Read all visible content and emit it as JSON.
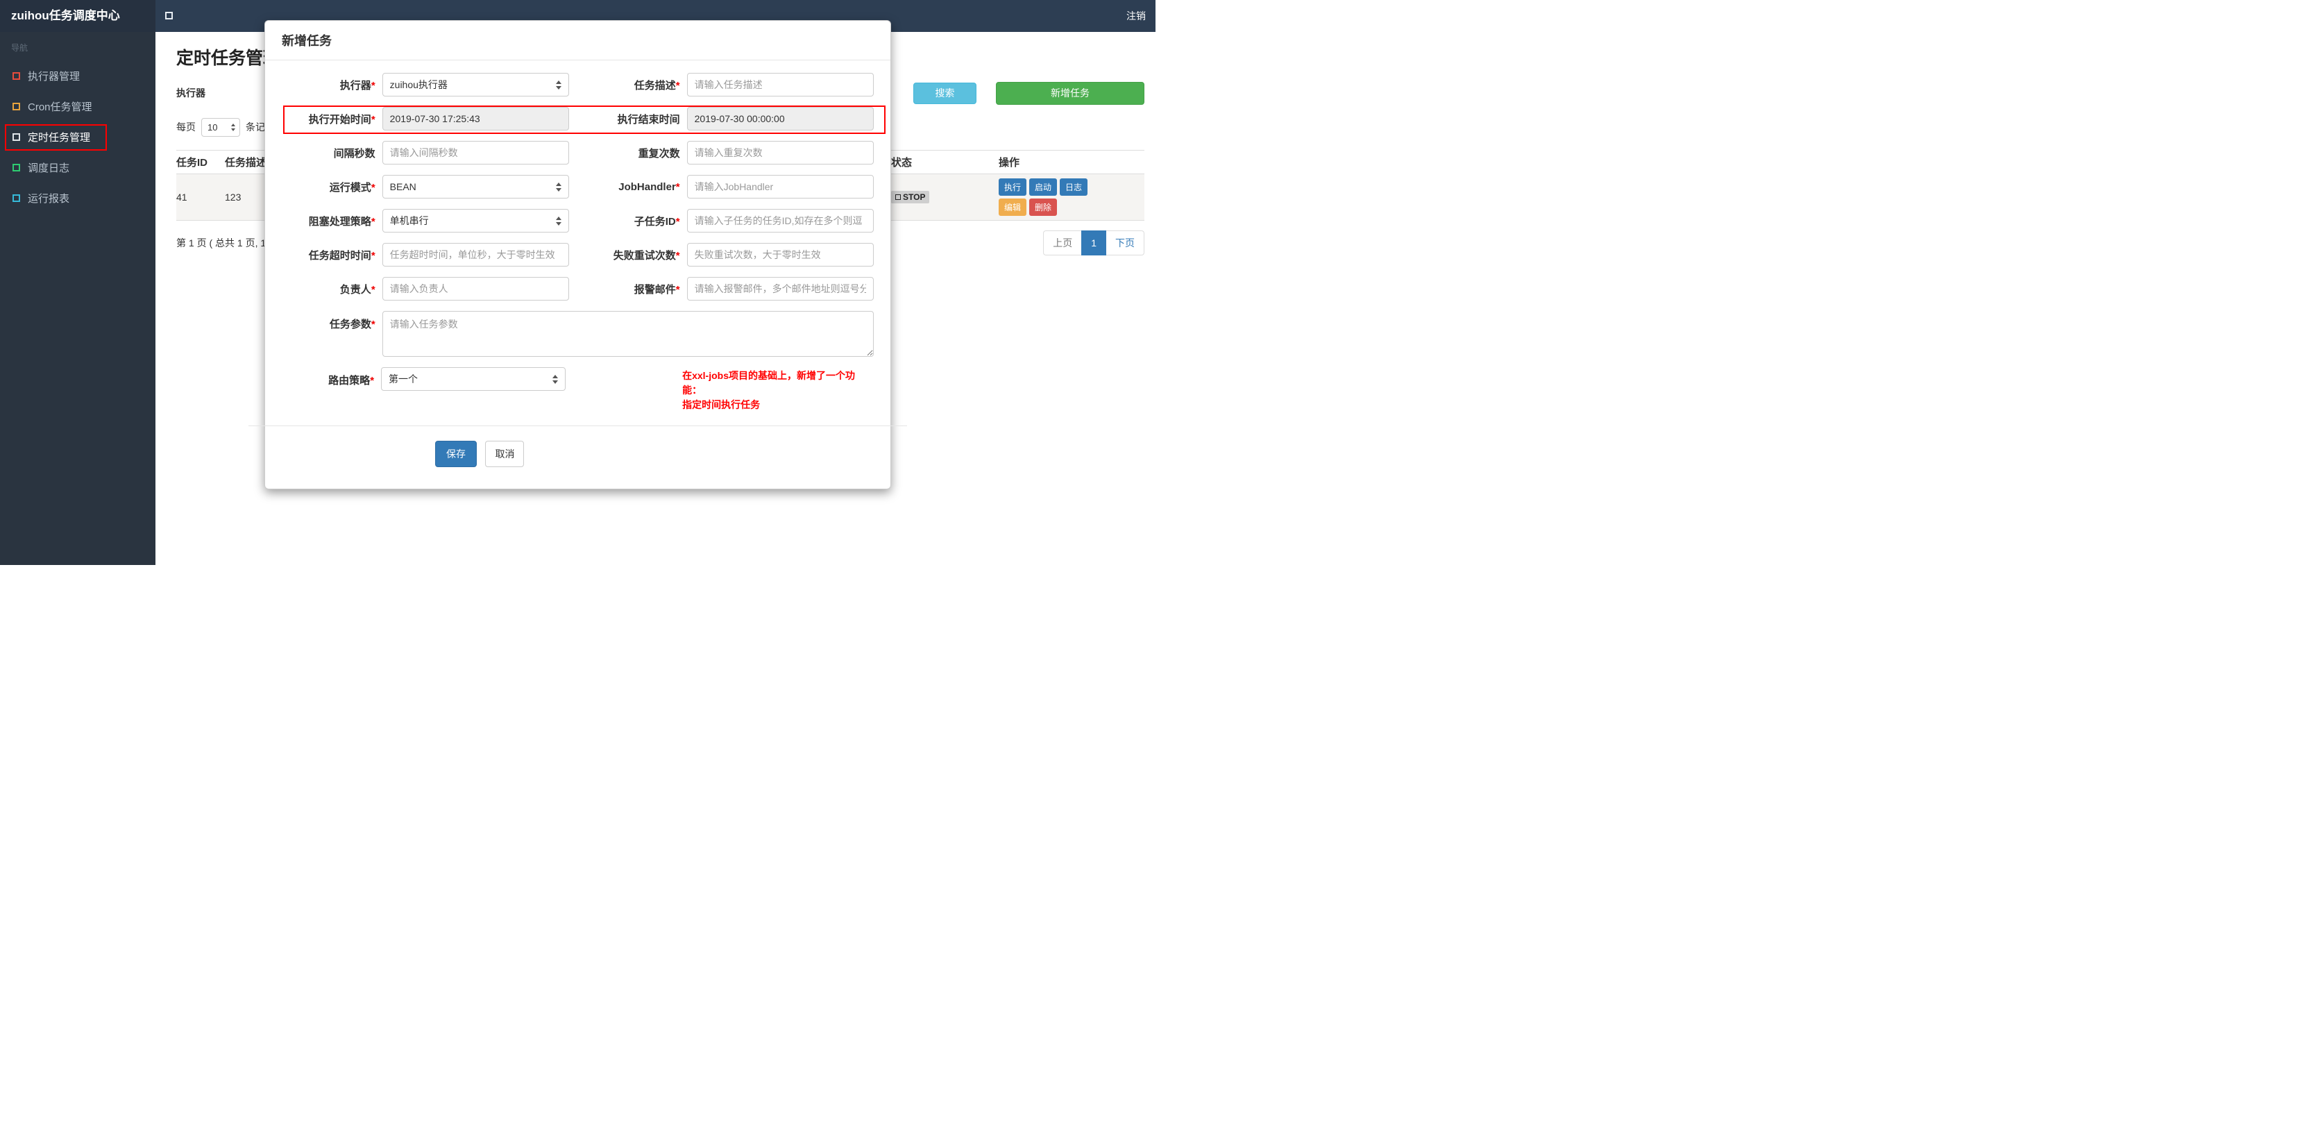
{
  "colors": {
    "navbar_bg": "#2d3e53",
    "sidebar_bg": "#2a3440",
    "search_btn": "#5bc0de",
    "add_btn": "#4caf50",
    "primary_blue": "#337ab7",
    "warn_orange": "#f0ad4e",
    "danger_red": "#d9534f",
    "annotation_red": "#ff0000"
  },
  "navbar": {
    "brand": "zuihou任务调度中心",
    "logout": "注销"
  },
  "sidebar": {
    "section_label": "导航",
    "items": [
      {
        "label": "执行器管理",
        "icon_color": "#e74c3c"
      },
      {
        "label": "Cron任务管理",
        "icon_color": "#e8a33d"
      },
      {
        "label": "定时任务管理",
        "icon_color": "#dfe4e8"
      },
      {
        "label": "调度日志",
        "icon_color": "#2ecc71"
      },
      {
        "label": "运行报表",
        "icon_color": "#36b9d8"
      }
    ]
  },
  "page": {
    "title": "定时任务管理",
    "toolbar": {
      "executor_label": "执行器",
      "search_button": "搜索",
      "add_button": "新增任务"
    },
    "per_page": {
      "label_left": "每页",
      "value": "10",
      "label_right": "条记"
    },
    "table": {
      "headers": [
        "任务ID",
        "任务描述",
        "状态",
        "操作"
      ],
      "row": {
        "id": "41",
        "desc": "123",
        "status": "STOP",
        "ops": [
          "执行",
          "启动",
          "日志",
          "编辑",
          "删除"
        ]
      }
    },
    "pagination": {
      "summary": "第 1 页 ( 总共 1 页, 1",
      "prev": "上页",
      "page": "1",
      "next": "下页"
    }
  },
  "modal": {
    "title": "新增任务",
    "fields": {
      "executor": {
        "label": "执行器",
        "star": "*",
        "value": "zuihou执行器"
      },
      "job_desc": {
        "label": "任务描述",
        "star": "*",
        "placeholder": "请输入任务描述"
      },
      "start_time": {
        "label": "执行开始时间",
        "star": "*",
        "value": "2019-07-30 17:25:43"
      },
      "end_time": {
        "label": "执行结束时间",
        "star": "",
        "value": "2019-07-30 00:00:00"
      },
      "interval": {
        "label": "间隔秒数",
        "star": "",
        "placeholder": "请输入间隔秒数"
      },
      "repeat": {
        "label": "重复次数",
        "star": "",
        "placeholder": "请输入重复次数"
      },
      "run_mode": {
        "label": "运行模式",
        "star": "*",
        "value": "BEAN"
      },
      "job_handler": {
        "label": "JobHandler",
        "star": "*",
        "placeholder": "请输入JobHandler"
      },
      "block_strategy": {
        "label": "阻塞处理策略",
        "star": "*",
        "value": "单机串行"
      },
      "child_job_id": {
        "label": "子任务ID",
        "star": "*",
        "placeholder": "请输入子任务的任务ID,如存在多个则逗"
      },
      "timeout": {
        "label": "任务超时时间",
        "star": "*",
        "placeholder": "任务超时时间，单位秒，大于零时生效"
      },
      "fail_retry": {
        "label": "失败重试次数",
        "star": "*",
        "placeholder": "失败重试次数，大于零时生效"
      },
      "owner": {
        "label": "负责人",
        "star": "*",
        "placeholder": "请输入负责人"
      },
      "alarm_email": {
        "label": "报警邮件",
        "star": "*",
        "placeholder": "请输入报警邮件，多个邮件地址则逗号分"
      },
      "job_param": {
        "label": "任务参数",
        "star": "*",
        "placeholder": "请输入任务参数"
      },
      "route_strategy": {
        "label": "路由策略",
        "star": "*",
        "value": "第一个"
      }
    },
    "note_line1": "在xxl-jobs项目的基础上，新增了一个功能：",
    "note_line2": "指定时间执行任务",
    "footer": {
      "save": "保存",
      "cancel": "取消"
    }
  }
}
